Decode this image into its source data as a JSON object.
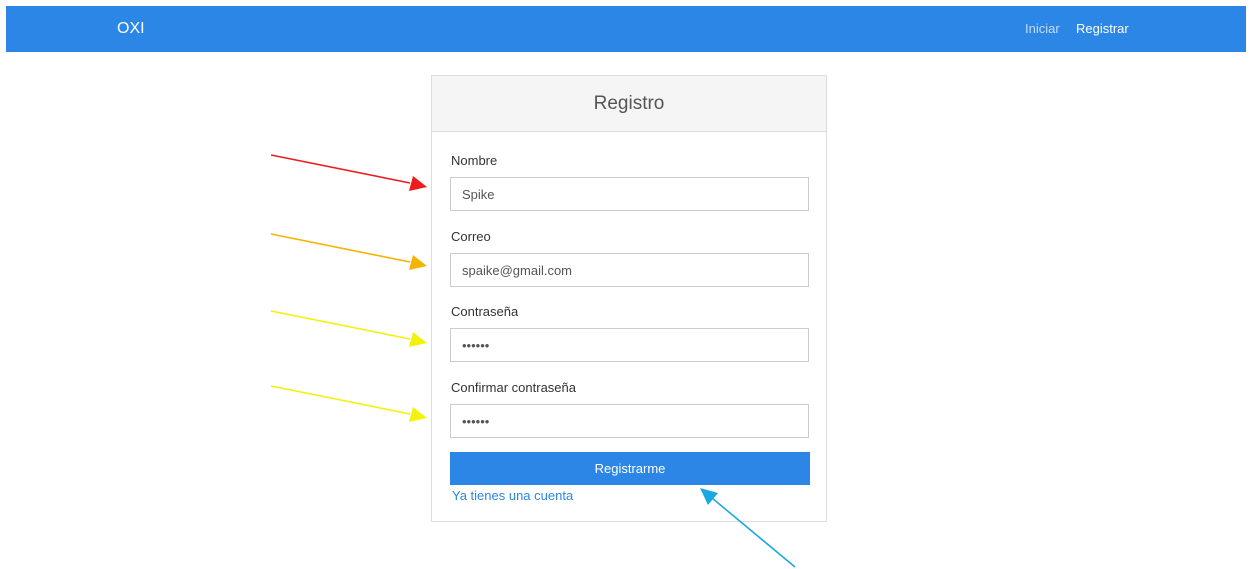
{
  "navbar": {
    "brand": "OXI",
    "links": [
      {
        "label": "Iniciar"
      },
      {
        "label": "Registrar"
      }
    ]
  },
  "form": {
    "title": "Registro",
    "fields": [
      {
        "label": "Nombre",
        "value": "Spike",
        "type": "text"
      },
      {
        "label": "Correo",
        "value": "spaike@gmail.com",
        "type": "email"
      },
      {
        "label": "Contraseña",
        "value": "••••••",
        "type": "password"
      },
      {
        "label": "Confirmar contraseña",
        "value": "••••••",
        "type": "password"
      }
    ],
    "submit_label": "Registrarme",
    "login_link": "Ya tienes una cuenta"
  },
  "annotations": {
    "arrow_colors": [
      "#ee1c1c",
      "#f5b400",
      "#f2f20a",
      "#f2f20a",
      "#1aa8e0"
    ]
  },
  "colors": {
    "primary": "#2b86e5",
    "header_bg": "#f5f5f5",
    "border": "#dddddd"
  }
}
